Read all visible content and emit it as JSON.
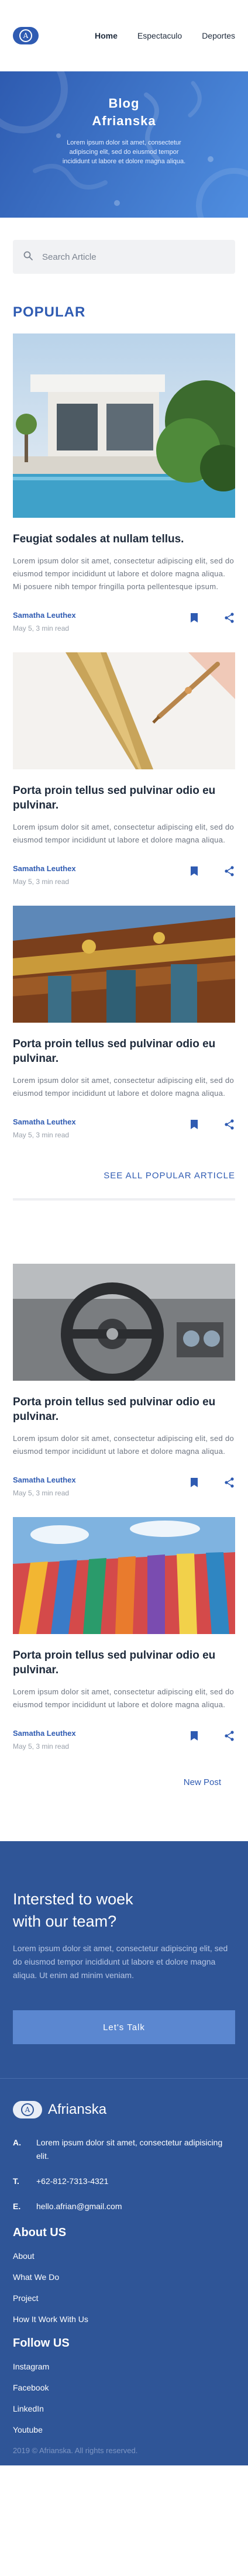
{
  "nav": {
    "logo_glyph": "A",
    "links": [
      "Home",
      "Espectaculo",
      "Deportes"
    ]
  },
  "hero": {
    "title_line1": "Blog",
    "title_line2": "Afrianska",
    "subtitle": "Lorem ipsum dolor sit amet, consectetur adipiscing elit, sed do eiusmod tempor incididunt ut labore et dolore magna aliqua."
  },
  "search": {
    "placeholder": "Search Article"
  },
  "popular": {
    "heading": "POPULAR",
    "see_all": "SEE ALL POPULAR ARTICLE",
    "cards": [
      {
        "image": "modern-house-photo",
        "title": "Feugiat sodales at nullam tellus.",
        "excerpt": "Lorem ipsum dolor sit amet, consectetur adipiscing elit, sed do eiusmod tempor incididunt ut labore et dolore magna aliqua. Mi posuere nibh tempor fringilla porta pellentesque ipsum.",
        "author": "Samatha Leuthex",
        "date": "May 5, 3 min read"
      },
      {
        "image": "golden-pen-photo",
        "title": "Porta proin tellus sed pulvinar odio eu pulvinar.",
        "excerpt": "Lorem ipsum dolor sit amet, consectetur adipiscing elit, sed do eiusmod tempor incididunt ut labore et dolore magna aliqua.",
        "author": "Samatha Leuthex",
        "date": "May 5, 3 min read"
      },
      {
        "image": "temple-roof-photo",
        "title": "Porta proin tellus sed pulvinar odio eu pulvinar.",
        "excerpt": "Lorem ipsum dolor sit amet, consectetur adipiscing elit, sed do eiusmod tempor incididunt ut labore et dolore magna aliqua.",
        "author": "Samatha Leuthex",
        "date": "May 5, 3 min read"
      }
    ]
  },
  "latest": {
    "cards": [
      {
        "image": "car-steering-wheel-photo",
        "title": "Porta proin tellus sed pulvinar odio eu pulvinar.",
        "excerpt": "Lorem ipsum dolor sit amet, consectetur adipiscing elit, sed do eiusmod tempor incididunt ut labore et dolore magna aliqua.",
        "author": "Samatha Leuthex",
        "date": "May 5, 3 min read"
      },
      {
        "image": "colorful-wall-photo",
        "title": "Porta proin tellus sed pulvinar odio eu pulvinar.",
        "excerpt": "Lorem ipsum dolor sit amet, consectetur adipiscing elit, sed do eiusmod tempor incididunt ut labore et dolore magna aliqua.",
        "author": "Samatha Leuthex",
        "date": "May 5, 3 min read"
      }
    ],
    "new_post": "New Post"
  },
  "cta": {
    "title_line1": "Intersted to woek",
    "title_line2": "with our team?",
    "text": "Lorem ipsum dolor sit amet, consectetur adipiscing elit, sed do eiusmod tempor incididunt ut labore et dolore magna aliqua. Ut enim ad minim veniam.",
    "button": "Let's Talk"
  },
  "footer": {
    "brand": "Afrianska",
    "contact": [
      {
        "key": "A.",
        "value": "Lorem ipsum dolor sit amet, consectetur adipisicing elit."
      },
      {
        "key": "T.",
        "value": "+62-812-7313-4321"
      },
      {
        "key": "E.",
        "value": "hello.afrian@gmail.com"
      }
    ],
    "about_heading": "About US",
    "about_links": [
      "About",
      "What We Do",
      "Project",
      "How It Work With Us"
    ],
    "follow_heading": "Follow US",
    "follow_links": [
      "Instagram",
      "Facebook",
      "LinkedIn",
      "Youtube"
    ],
    "copyright": "2019 © Afrianska. All rights reserved."
  },
  "colors": {
    "brand": "#2f5bb2",
    "footer_bg": "#2f5597",
    "cta_button": "#5b87d0"
  }
}
